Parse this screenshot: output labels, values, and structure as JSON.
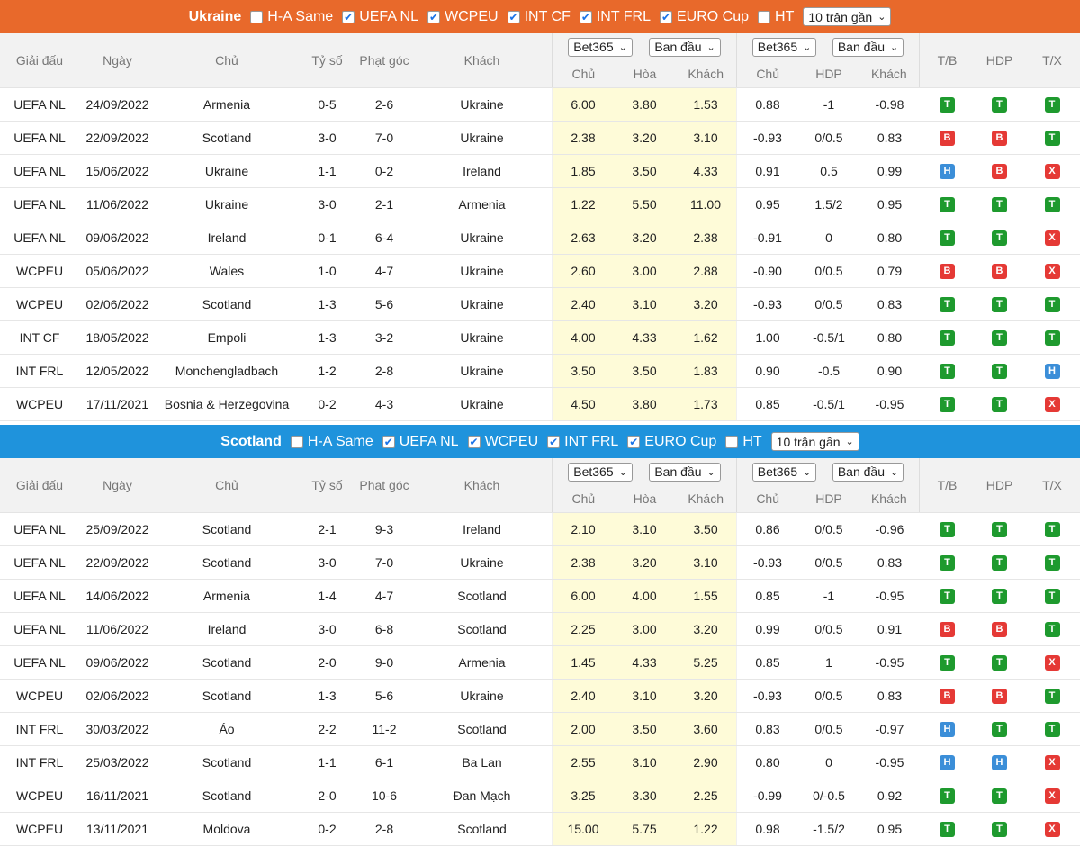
{
  "common": {
    "headers": {
      "league": "Giải đấu",
      "date": "Ngày",
      "home": "Chủ",
      "score": "Tỷ số",
      "corner": "Phạt góc",
      "away": "Khách",
      "bookmaker": "Bet365",
      "odds_type": "Ban đầu",
      "odds_home": "Chủ",
      "odds_draw": "Hòa",
      "odds_away": "Khách",
      "ah_home": "Chủ",
      "ah_hdp": "HDP",
      "ah_away": "Khách",
      "tb": "T/B",
      "hdp": "HDP",
      "tx": "T/X"
    }
  },
  "ukraine": {
    "team": "Ukraine",
    "filters": {
      "ha_same": "H-A Same",
      "uefa_nl": "UEFA NL",
      "wcpeu": "WCPEU",
      "int_cf": "INT CF",
      "int_frl": "INT FRL",
      "euro_cup": "EURO Cup",
      "ht": "HT",
      "range": "10 trận gần"
    },
    "rows": [
      {
        "league": "UEFA NL",
        "date": "24/09/2022",
        "home": "Armenia",
        "score": "0-5",
        "corner": "2-6",
        "away": "Ukraine",
        "o1": "6.00",
        "o2": "3.80",
        "o3": "1.53",
        "a1": "0.88",
        "a2": "-1",
        "a3": "-0.98",
        "tb": "T",
        "hdp": "T",
        "tx": "T",
        "hl": "away"
      },
      {
        "league": "UEFA NL",
        "date": "22/09/2022",
        "home": "Scotland",
        "score": "3-0",
        "corner": "7-0",
        "away": "Ukraine",
        "o1": "2.38",
        "o2": "3.20",
        "o3": "3.10",
        "a1": "-0.93",
        "a2": "0/0.5",
        "a3": "0.83",
        "tb": "B",
        "hdp": "B",
        "tx": "T",
        "hl": "away"
      },
      {
        "league": "UEFA NL",
        "date": "15/06/2022",
        "home": "Ukraine",
        "score": "1-1",
        "corner": "0-2",
        "away": "Ireland",
        "o1": "1.85",
        "o2": "3.50",
        "o3": "4.33",
        "a1": "0.91",
        "a2": "0.5",
        "a3": "0.99",
        "tb": "H",
        "hdp": "B",
        "tx": "X",
        "hl": "home"
      },
      {
        "league": "UEFA NL",
        "date": "11/06/2022",
        "home": "Ukraine",
        "score": "3-0",
        "corner": "2-1",
        "away": "Armenia",
        "o1": "1.22",
        "o2": "5.50",
        "o3": "11.00",
        "a1": "0.95",
        "a2": "1.5/2",
        "a3": "0.95",
        "tb": "T",
        "hdp": "T",
        "tx": "T",
        "hl": "home"
      },
      {
        "league": "UEFA NL",
        "date": "09/06/2022",
        "home": "Ireland",
        "score": "0-1",
        "corner": "6-4",
        "away": "Ukraine",
        "o1": "2.63",
        "o2": "3.20",
        "o3": "2.38",
        "a1": "-0.91",
        "a2": "0",
        "a3": "0.80",
        "tb": "T",
        "hdp": "T",
        "tx": "X",
        "hl": "away"
      },
      {
        "league": "WCPEU",
        "date": "05/06/2022",
        "home": "Wales",
        "score": "1-0",
        "corner": "4-7",
        "away": "Ukraine",
        "o1": "2.60",
        "o2": "3.00",
        "o3": "2.88",
        "a1": "-0.90",
        "a2": "0/0.5",
        "a3": "0.79",
        "tb": "B",
        "hdp": "B",
        "tx": "X",
        "hl": "away"
      },
      {
        "league": "WCPEU",
        "date": "02/06/2022",
        "home": "Scotland",
        "score": "1-3",
        "corner": "5-6",
        "away": "Ukraine",
        "o1": "2.40",
        "o2": "3.10",
        "o3": "3.20",
        "a1": "-0.93",
        "a2": "0/0.5",
        "a3": "0.83",
        "tb": "T",
        "hdp": "T",
        "tx": "T",
        "hl": "away"
      },
      {
        "league": "INT CF",
        "date": "18/05/2022",
        "home": "Empoli",
        "score": "1-3",
        "corner": "3-2",
        "away": "Ukraine",
        "o1": "4.00",
        "o2": "4.33",
        "o3": "1.62",
        "a1": "1.00",
        "a2": "-0.5/1",
        "a3": "0.80",
        "tb": "T",
        "hdp": "T",
        "tx": "T",
        "hl": "away"
      },
      {
        "league": "INT FRL",
        "date": "12/05/2022",
        "home": "Monchengladbach",
        "score": "1-2",
        "corner": "2-8",
        "away": "Ukraine",
        "o1": "3.50",
        "o2": "3.50",
        "o3": "1.83",
        "a1": "0.90",
        "a2": "-0.5",
        "a3": "0.90",
        "tb": "T",
        "hdp": "T",
        "tx": "H",
        "hl": "away"
      },
      {
        "league": "WCPEU",
        "date": "17/11/2021",
        "home": "Bosnia & Herzegovina",
        "score": "0-2",
        "corner": "4-3",
        "away": "Ukraine",
        "o1": "4.50",
        "o2": "3.80",
        "o3": "1.73",
        "a1": "0.85",
        "a2": "-0.5/1",
        "a3": "-0.95",
        "tb": "T",
        "hdp": "T",
        "tx": "X",
        "hl": "away"
      }
    ]
  },
  "scotland": {
    "team": "Scotland",
    "filters": {
      "ha_same": "H-A Same",
      "uefa_nl": "UEFA NL",
      "wcpeu": "WCPEU",
      "int_frl": "INT FRL",
      "euro_cup": "EURO Cup",
      "ht": "HT",
      "range": "10 trận gần"
    },
    "rows": [
      {
        "league": "UEFA NL",
        "date": "25/09/2022",
        "home": "Scotland",
        "score": "2-1",
        "corner": "9-3",
        "away": "Ireland",
        "o1": "2.10",
        "o2": "3.10",
        "o3": "3.50",
        "a1": "0.86",
        "a2": "0/0.5",
        "a3": "-0.96",
        "tb": "T",
        "hdp": "T",
        "tx": "T",
        "hl": "home"
      },
      {
        "league": "UEFA NL",
        "date": "22/09/2022",
        "home": "Scotland",
        "score": "3-0",
        "corner": "7-0",
        "away": "Ukraine",
        "o1": "2.38",
        "o2": "3.20",
        "o3": "3.10",
        "a1": "-0.93",
        "a2": "0/0.5",
        "a3": "0.83",
        "tb": "T",
        "hdp": "T",
        "tx": "T",
        "hl": "home"
      },
      {
        "league": "UEFA NL",
        "date": "14/06/2022",
        "home": "Armenia",
        "score": "1-4",
        "corner": "4-7",
        "away": "Scotland",
        "o1": "6.00",
        "o2": "4.00",
        "o3": "1.55",
        "a1": "0.85",
        "a2": "-1",
        "a3": "-0.95",
        "tb": "T",
        "hdp": "T",
        "tx": "T",
        "hl": "away"
      },
      {
        "league": "UEFA NL",
        "date": "11/06/2022",
        "home": "Ireland",
        "score": "3-0",
        "corner": "6-8",
        "away": "Scotland",
        "o1": "2.25",
        "o2": "3.00",
        "o3": "3.20",
        "a1": "0.99",
        "a2": "0/0.5",
        "a3": "0.91",
        "tb": "B",
        "hdp": "B",
        "tx": "T",
        "hl": "away"
      },
      {
        "league": "UEFA NL",
        "date": "09/06/2022",
        "home": "Scotland",
        "score": "2-0",
        "corner": "9-0",
        "away": "Armenia",
        "o1": "1.45",
        "o2": "4.33",
        "o3": "5.25",
        "a1": "0.85",
        "a2": "1",
        "a3": "-0.95",
        "tb": "T",
        "hdp": "T",
        "tx": "X",
        "hl": "home"
      },
      {
        "league": "WCPEU",
        "date": "02/06/2022",
        "home": "Scotland",
        "score": "1-3",
        "corner": "5-6",
        "away": "Ukraine",
        "o1": "2.40",
        "o2": "3.10",
        "o3": "3.20",
        "a1": "-0.93",
        "a2": "0/0.5",
        "a3": "0.83",
        "tb": "B",
        "hdp": "B",
        "tx": "T",
        "hl": "home"
      },
      {
        "league": "INT FRL",
        "date": "30/03/2022",
        "home": "Áo",
        "score": "2-2",
        "corner": "11-2",
        "away": "Scotland",
        "o1": "2.00",
        "o2": "3.50",
        "o3": "3.60",
        "a1": "0.83",
        "a2": "0/0.5",
        "a3": "-0.97",
        "tb": "H",
        "hdp": "T",
        "tx": "T",
        "hl": "away"
      },
      {
        "league": "INT FRL",
        "date": "25/03/2022",
        "home": "Scotland",
        "score": "1-1",
        "corner": "6-1",
        "away": "Ba Lan",
        "o1": "2.55",
        "o2": "3.10",
        "o3": "2.90",
        "a1": "0.80",
        "a2": "0",
        "a3": "-0.95",
        "tb": "H",
        "hdp": "H",
        "tx": "X",
        "hl": "home"
      },
      {
        "league": "WCPEU",
        "date": "16/11/2021",
        "home": "Scotland",
        "score": "2-0",
        "corner": "10-6",
        "away": "Đan Mạch",
        "o1": "3.25",
        "o2": "3.30",
        "o3": "2.25",
        "a1": "-0.99",
        "a2": "0/-0.5",
        "a3": "0.92",
        "tb": "T",
        "hdp": "T",
        "tx": "X",
        "hl": "home"
      },
      {
        "league": "WCPEU",
        "date": "13/11/2021",
        "home": "Moldova",
        "score": "0-2",
        "corner": "2-8",
        "away": "Scotland",
        "o1": "15.00",
        "o2": "5.75",
        "o3": "1.22",
        "a1": "0.98",
        "a2": "-1.5/2",
        "a3": "0.95",
        "tb": "T",
        "hdp": "T",
        "tx": "X",
        "hl": "away"
      }
    ]
  },
  "colors": {
    "orange": "#e8692b",
    "blue": "#1f93dc",
    "win": "#1e9a2e",
    "loss": "#e53935",
    "draw": "#3b8ed8",
    "odds_bg": "#fefbd8"
  }
}
